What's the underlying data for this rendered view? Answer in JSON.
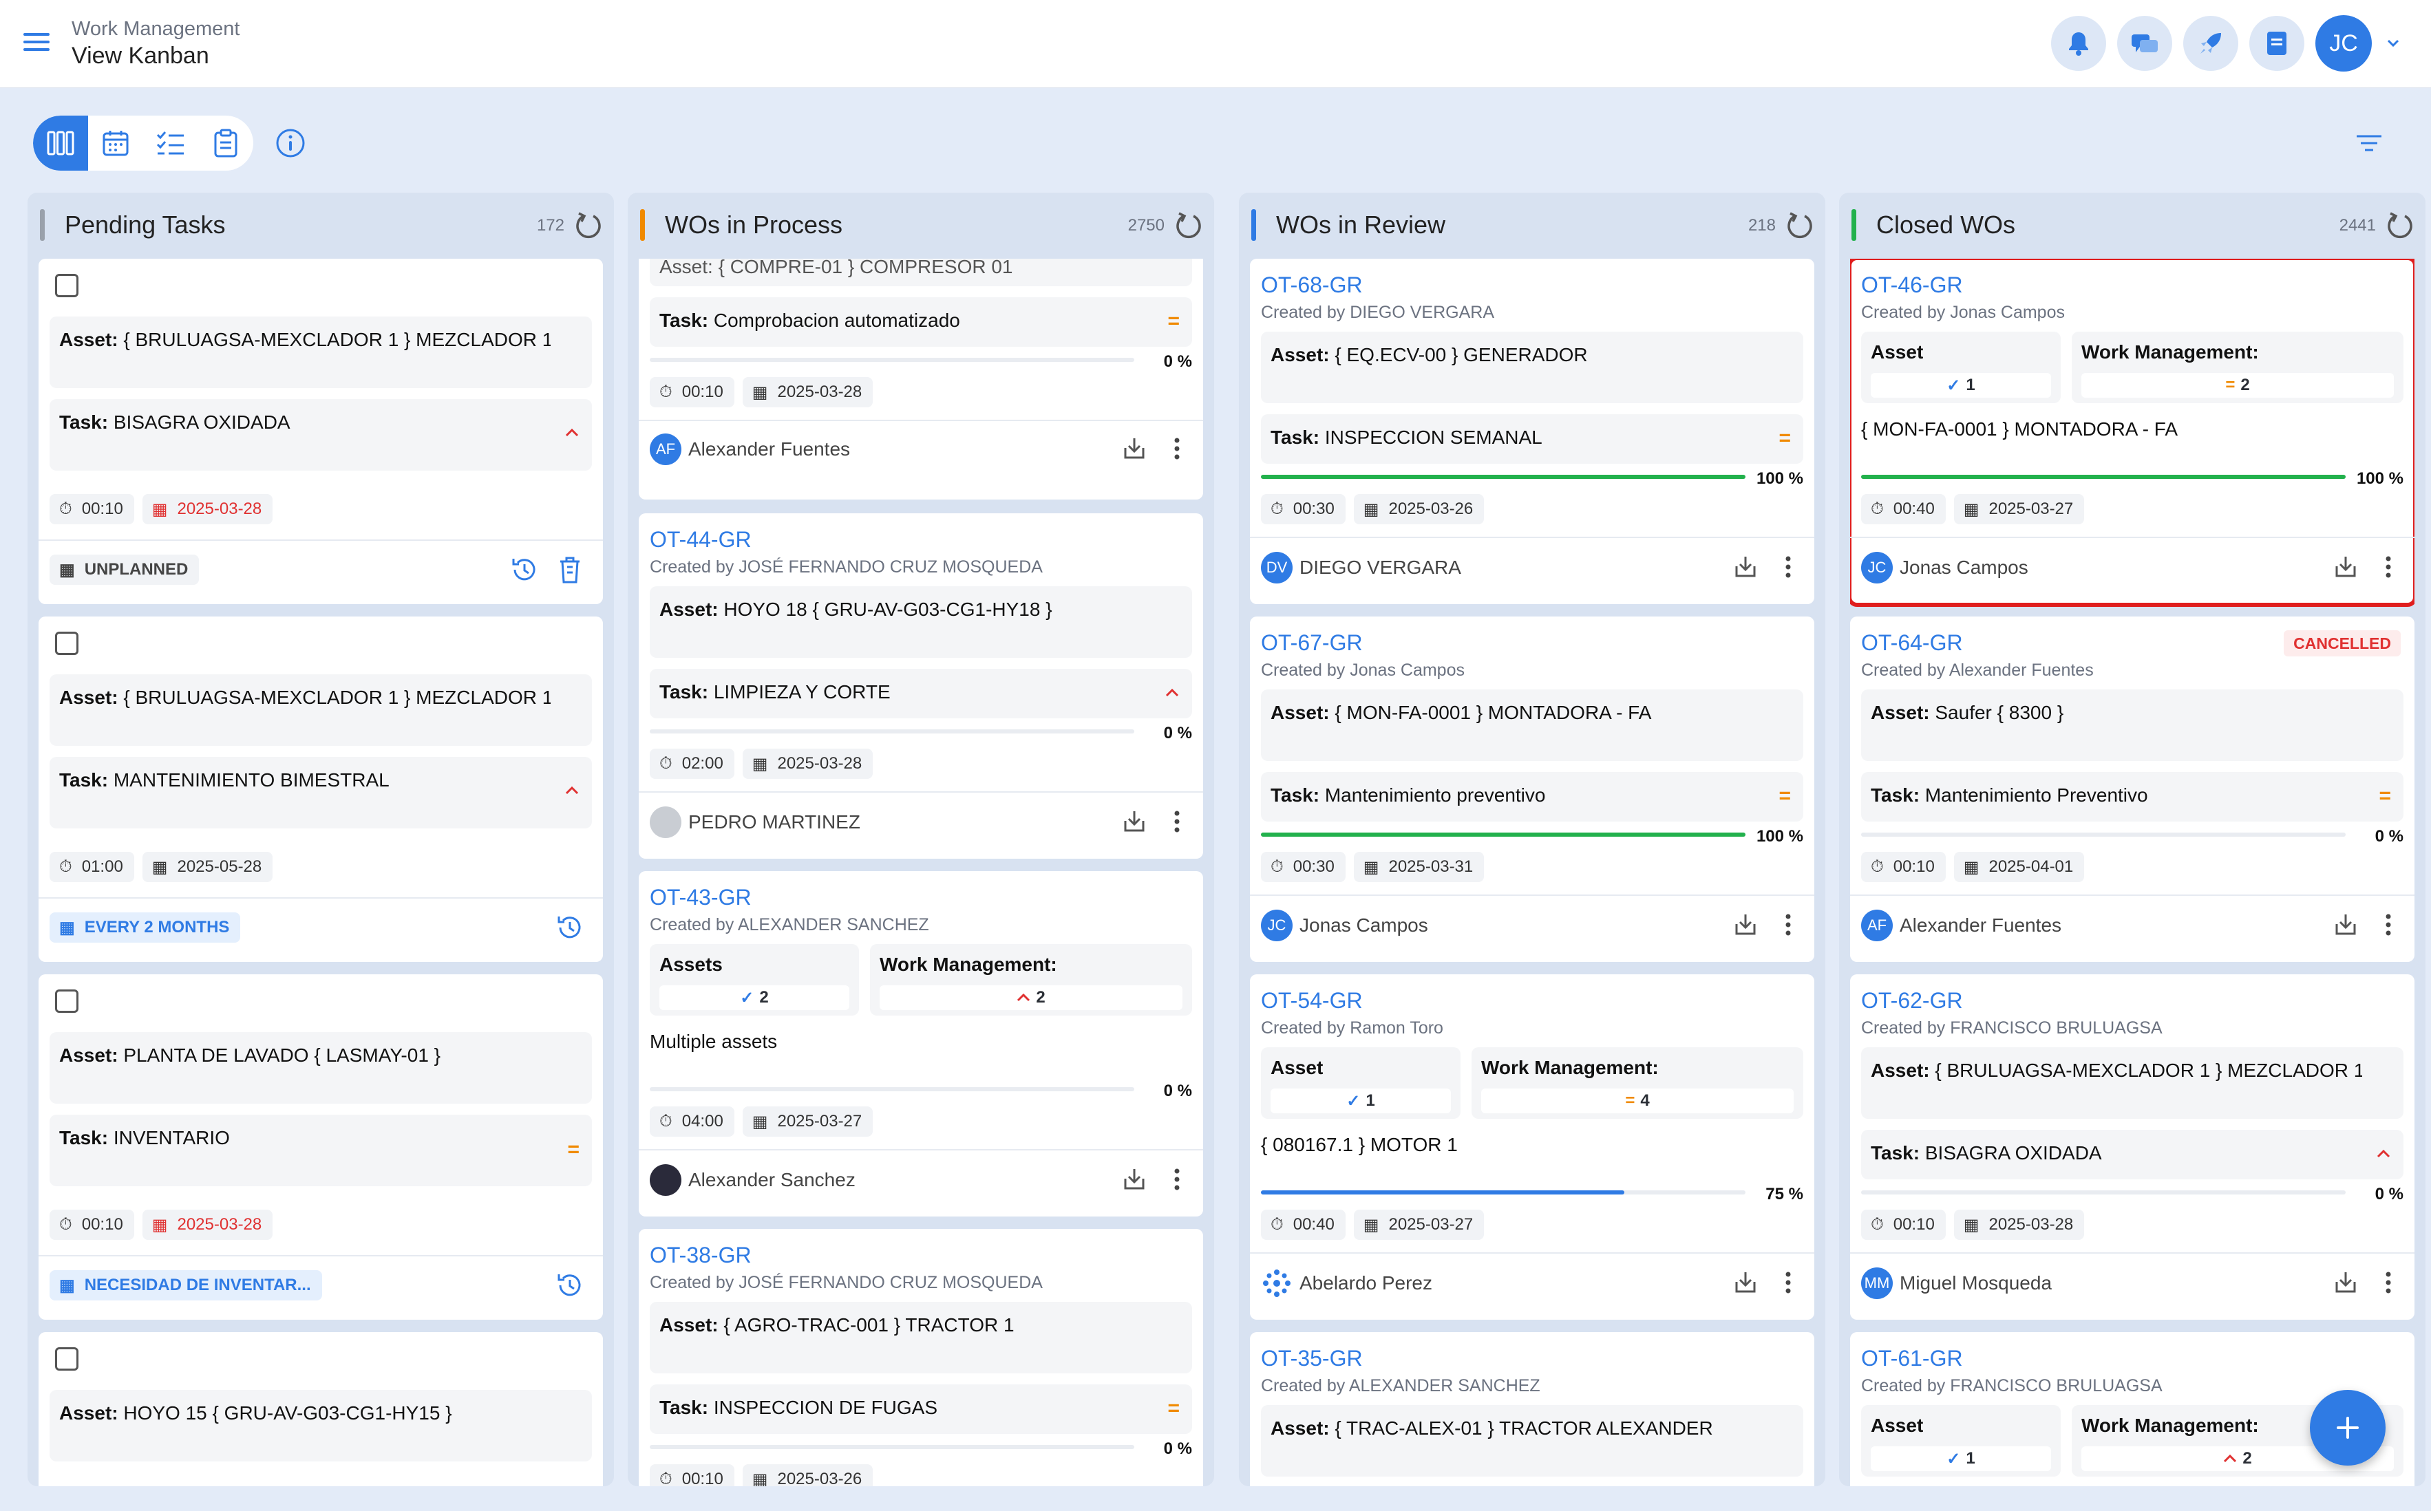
{
  "header": {
    "app_title": "Work Management",
    "page_title": "View Kanban",
    "user_initials": "JC"
  },
  "icons": {
    "menu": "hamburger-icon",
    "notifications": "bell-icon",
    "chat": "chat-icon",
    "launch": "rocket-icon",
    "docs": "document-icon",
    "kanban": "kanban-columns-icon",
    "calendar": "calendar-icon",
    "list": "checklist-icon",
    "clipboard": "clipboard-icon",
    "info": "info-icon",
    "filter": "filter-icon",
    "add": "plus-icon"
  },
  "colors": {
    "accent": "#2f7be4",
    "pending": "#9aa1ab",
    "process": "#f08a00",
    "review": "#2f7be4",
    "closed": "#22b14c",
    "danger": "#e03131"
  },
  "columns": [
    {
      "title": "Pending Tasks",
      "count": "172",
      "cards": [
        {
          "asset_label": "Asset:",
          "asset": "{ BRULUAGSA-MEXCLADOR 1 } MEZCLADOR 1",
          "task_label": "Task:",
          "task": "BISAGRA OXIDADA",
          "priority": "^",
          "duration": "00:10",
          "date": "2025-03-28",
          "badge": "UNPLANNED"
        },
        {
          "asset_label": "Asset:",
          "asset": "{ BRULUAGSA-MEXCLADOR 1 } MEZCLADOR 1",
          "task_label": "Task:",
          "task": "MANTENIMIENTO BIMESTRAL",
          "priority": "^",
          "duration": "01:00",
          "date": "2025-05-28",
          "badge": "EVERY 2 MONTHS"
        },
        {
          "asset_label": "Asset:",
          "asset": "PLANTA DE LAVADO { LASMAY-01 }",
          "task_label": "Task:",
          "task": "INVENTARIO",
          "priority": "=",
          "duration": "00:10",
          "date": "2025-03-28",
          "badge": "NECESIDAD DE INVENTAR..."
        },
        {
          "asset_label": "Asset:",
          "asset": "HOYO 15 { GRU-AV-G03-CG1-HY15 }"
        }
      ]
    },
    {
      "title": "WOs in Process",
      "count": "2750",
      "cards": [
        {
          "asset_partial": "Asset: { COMPRE-01 } COMPRESOR 01",
          "task_label": "Task:",
          "task": "Comprobacion automatizado",
          "priority": "=",
          "progress": "0 %",
          "duration": "00:10",
          "date": "2025-03-28",
          "person": "Alexander Fuentes",
          "initials": "AF"
        },
        {
          "id": "OT-44-GR",
          "created": "Created by JOSÉ FERNANDO CRUZ MOSQUEDA",
          "asset_label": "Asset:",
          "asset": "HOYO 18 { GRU-AV-G03-CG1-HY18 }",
          "task_label": "Task:",
          "task": "LIMPIEZA Y CORTE",
          "priority": "^",
          "progress": "0 %",
          "duration": "02:00",
          "date": "2025-03-28",
          "person": "PEDRO MARTINEZ"
        },
        {
          "id": "OT-43-GR",
          "created": "Created by ALEXANDER SANCHEZ",
          "assets_label": "Assets",
          "assets_count": "2",
          "wm_label": "Work Management:",
          "wm_count": "2",
          "description": "Multiple assets",
          "progress": "0 %",
          "duration": "04:00",
          "date": "2025-03-27",
          "person": "Alexander Sanchez"
        },
        {
          "id": "OT-38-GR",
          "created": "Created by JOSÉ FERNANDO CRUZ MOSQUEDA",
          "asset_label": "Asset:",
          "asset": "{ AGRO-TRAC-001 } TRACTOR 1",
          "task_label": "Task:",
          "task": "INSPECCION DE FUGAS",
          "priority": "=",
          "progress": "0 %",
          "duration": "00:10",
          "date": "2025-03-26"
        }
      ]
    },
    {
      "title": "WOs in Review",
      "count": "218",
      "cards": [
        {
          "id": "OT-68-GR",
          "created": "Created by DIEGO VERGARA",
          "asset_label": "Asset:",
          "asset": "{ EQ.ECV-00 } GENERADOR",
          "task_label": "Task:",
          "task": "INSPECCION SEMANAL",
          "priority": "=",
          "progress": "100 %",
          "progress_value": 1.0,
          "duration": "00:30",
          "date": "2025-03-26",
          "person": "DIEGO VERGARA",
          "initials": "DV"
        },
        {
          "id": "OT-67-GR",
          "created": "Created by Jonas Campos",
          "asset_label": "Asset:",
          "asset": "{ MON-FA-0001 } MONTADORA - FA",
          "task_label": "Task:",
          "task": "Mantenimiento preventivo",
          "priority": "=",
          "progress": "100 %",
          "progress_value": 1.0,
          "duration": "00:30",
          "date": "2025-03-31",
          "person": "Jonas Campos",
          "initials": "JC"
        },
        {
          "id": "OT-54-GR",
          "created": "Created by Ramon Toro",
          "assets_label": "Asset",
          "assets_count": "1",
          "wm_label": "Work Management:",
          "wm_count": "4",
          "description": "{ 080167.1 } MOTOR 1",
          "progress": "75 %",
          "progress_value": 0.75,
          "duration": "00:40",
          "date": "2025-03-27",
          "person": "Abelardo Perez"
        },
        {
          "id": "OT-35-GR",
          "created": "Created by ALEXANDER SANCHEZ",
          "asset_label": "Asset:",
          "asset": "{ TRAC-ALEX-01 } TRACTOR ALEXANDER"
        }
      ]
    },
    {
      "title": "Closed WOs",
      "count": "2441",
      "cards": [
        {
          "id": "OT-46-GR",
          "created": "Created by Jonas Campos",
          "assets_label": "Asset",
          "assets_count": "1",
          "wm_label": "Work Management:",
          "wm_count": "2",
          "description": "{ MON-FA-0001 } MONTADORA - FA",
          "progress": "100 %",
          "progress_value": 1.0,
          "duration": "00:40",
          "date": "2025-03-27",
          "person": "Jonas Campos",
          "initials": "JC"
        },
        {
          "id": "OT-64-GR",
          "status": "CANCELLED",
          "created": "Created by Alexander Fuentes",
          "asset_label": "Asset:",
          "asset": "Saufer { 8300 }",
          "task_label": "Task:",
          "task": "Mantenimiento Preventivo",
          "priority": "=",
          "progress": "0 %",
          "duration": "00:10",
          "date": "2025-04-01",
          "person": "Alexander Fuentes",
          "initials": "AF"
        },
        {
          "id": "OT-62-GR",
          "created": "Created by FRANCISCO BRULUAGSA",
          "asset_label": "Asset:",
          "asset": "{ BRULUAGSA-MEXCLADOR 1 } MEZCLADOR 1",
          "task_label": "Task:",
          "task": "BISAGRA OXIDADA",
          "priority": "^",
          "progress": "0 %",
          "duration": "00:10",
          "date": "2025-03-28",
          "person": "Miguel Mosqueda",
          "initials": "MM"
        },
        {
          "id": "OT-61-GR",
          "created": "Created by FRANCISCO BRULUAGSA",
          "assets_label": "Asset",
          "assets_count": "1",
          "wm_label": "Work Management:",
          "wm_count": "2"
        }
      ]
    }
  ]
}
